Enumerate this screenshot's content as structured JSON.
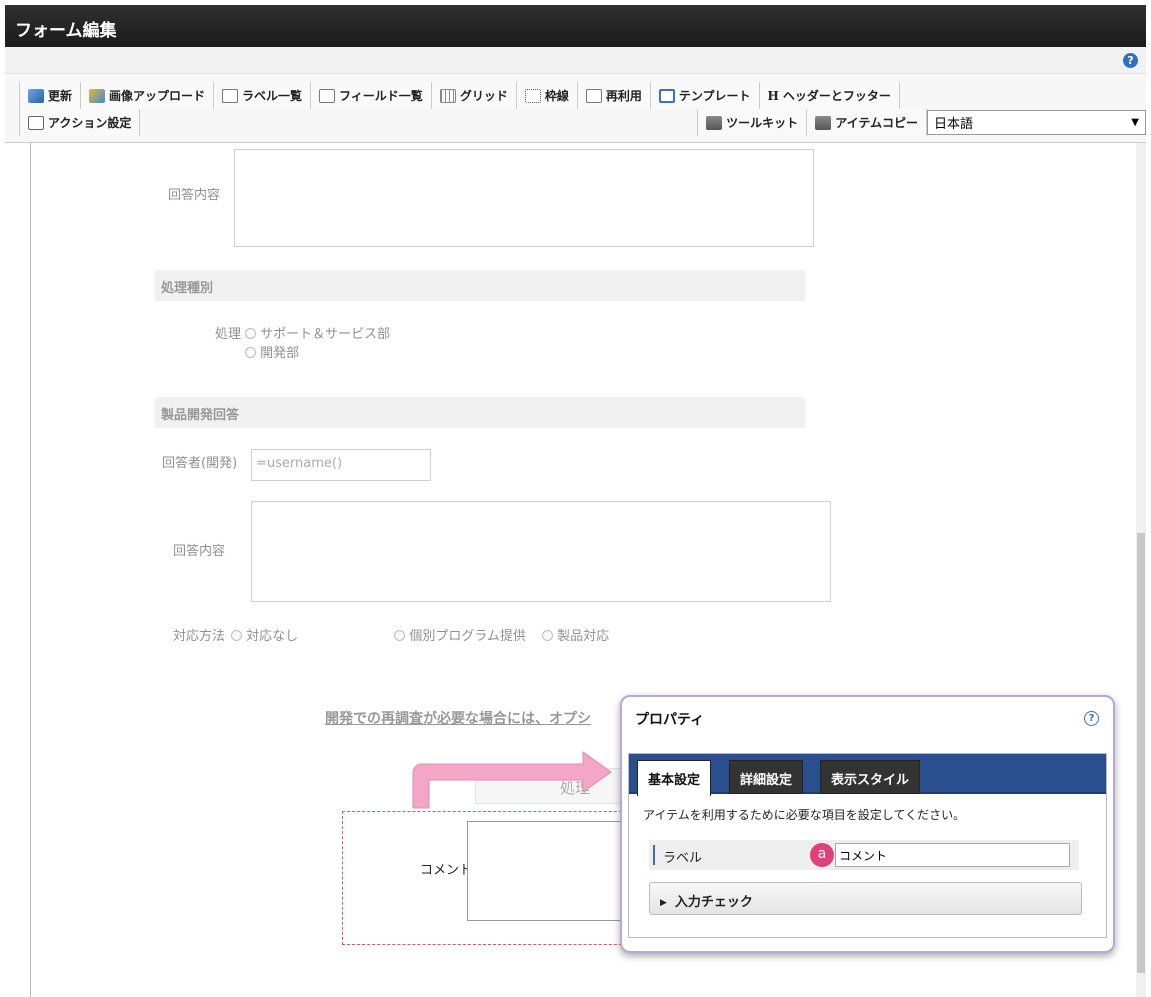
{
  "window": {
    "title": "フォーム編集",
    "help": "?"
  },
  "toolbar": {
    "row1": [
      {
        "label": "更新",
        "icon": "refresh-icon"
      },
      {
        "label": "画像アップロード",
        "icon": "image-upload-icon"
      },
      {
        "label": "ラベル一覧",
        "icon": "label-list-icon"
      },
      {
        "label": "フィールド一覧",
        "icon": "field-list-icon"
      },
      {
        "label": "グリッド",
        "icon": "grid-icon"
      },
      {
        "label": "枠線",
        "icon": "frame-icon"
      },
      {
        "label": "再利用",
        "icon": "reuse-icon"
      },
      {
        "label": "テンプレート",
        "icon": "template-icon"
      },
      {
        "label": "ヘッダーとフッター",
        "icon": "header-footer-icon",
        "glyph": "H"
      }
    ],
    "action_settings": "アクション設定",
    "toolkit": "ツールキット",
    "item_copy": "アイテムコピー",
    "language": "日本語",
    "dropdown_arrow": "▼"
  },
  "form": {
    "answer_label_1": "回答内容",
    "section_process": "処理種別",
    "process_label": "処理",
    "process_options": [
      "サポート＆サービス部",
      "開発部"
    ],
    "section_product": "製品開発回答",
    "responder_label": "回答者(開発)",
    "responder_value": "=username()",
    "answer_label_2": "回答内容",
    "method_label": "対応方法",
    "method_options": [
      "対応なし",
      "個別プログラム提供",
      "製品対応"
    ],
    "note": "開発での再調査が必要な場合には、オプシ",
    "process_button": "処理",
    "comment_label": "コメント"
  },
  "properties": {
    "title": "プロパティ",
    "help": "?",
    "tabs": [
      "基本設定",
      "詳細設定",
      "表示スタイル"
    ],
    "description": "アイテムを利用するために必要な項目を設定してください。",
    "label_name": "ラベル",
    "badge": "a",
    "label_value": "コメント",
    "expander": "入力チェック"
  },
  "colors": {
    "accent": "#2a4f8f",
    "badge": "#e04178",
    "arrow": "#f4a6c6"
  }
}
